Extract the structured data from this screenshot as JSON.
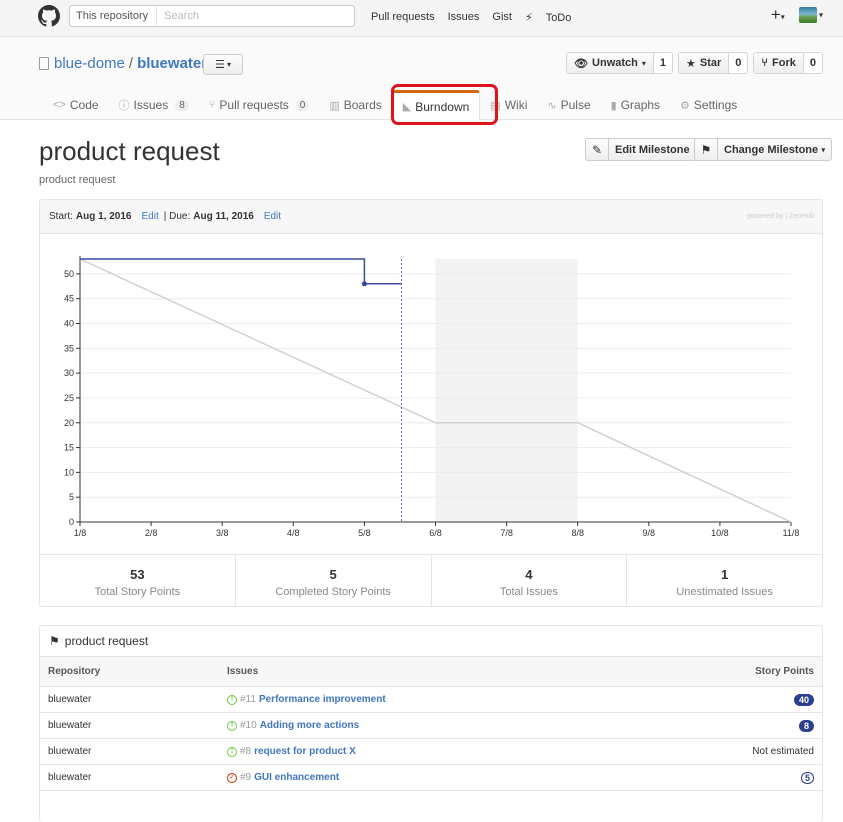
{
  "header": {
    "search_scope": "This repository",
    "search_placeholder": "Search",
    "nav": [
      "Pull requests",
      "Issues",
      "Gist",
      "ToDo"
    ]
  },
  "repo": {
    "owner": "blue-dome",
    "name": "bluewater",
    "watch_label": "Unwatch",
    "watch_count": "1",
    "star_label": "Star",
    "star_count": "0",
    "fork_label": "Fork",
    "fork_count": "0"
  },
  "tabs": [
    {
      "label": "Code",
      "icon": "code-icon"
    },
    {
      "label": "Issues",
      "icon": "issue-icon",
      "badge": "8"
    },
    {
      "label": "Pull requests",
      "icon": "pull-request-icon",
      "badge": "0"
    },
    {
      "label": "Boards",
      "icon": "boards-icon"
    },
    {
      "label": "Burndown",
      "icon": "burndown-icon",
      "active": true
    },
    {
      "label": "Wiki",
      "icon": "wiki-icon"
    },
    {
      "label": "Pulse",
      "icon": "pulse-icon"
    },
    {
      "label": "Graphs",
      "icon": "graphs-icon"
    },
    {
      "label": "Settings",
      "icon": "gear-icon"
    }
  ],
  "milestone": {
    "title": "product request",
    "subtitle": "product request",
    "edit_label": "Edit Milestone",
    "change_label": "Change Milestone"
  },
  "burndown": {
    "start_label": "Start:",
    "start_date": "Aug 1, 2016",
    "edit1": "Edit",
    "due_label": "| Due:",
    "due_date": "Aug 11, 2016",
    "edit2": "Edit",
    "powered": "powered by | ZenHub"
  },
  "chart_data": {
    "type": "line",
    "x_ticks": [
      "1/8",
      "2/8",
      "3/8",
      "4/8",
      "5/8",
      "6/8",
      "7/8",
      "8/8",
      "9/8",
      "10/8",
      "11/8"
    ],
    "y_ticks": [
      0,
      5,
      10,
      15,
      20,
      25,
      30,
      35,
      40,
      45,
      50
    ],
    "ylim": [
      0,
      53
    ],
    "series": [
      {
        "values": [
          [
            0,
            53
          ],
          [
            5,
            20
          ],
          [
            7,
            20
          ],
          [
            10,
            0
          ]
        ],
        "color": "#d0d0d0"
      },
      {
        "values": [
          [
            0,
            53
          ],
          [
            4,
            53
          ],
          [
            4,
            48
          ],
          [
            4.52,
            48
          ]
        ],
        "color": "#3a4ba0"
      }
    ],
    "today_x": 4.52,
    "weekend_range": [
      5,
      7
    ],
    "grid": true
  },
  "stats": [
    {
      "value": "53",
      "label": "Total Story Points"
    },
    {
      "value": "5",
      "label": "Completed Story Points"
    },
    {
      "value": "4",
      "label": "Total Issues"
    },
    {
      "value": "1",
      "label": "Unestimated Issues"
    }
  ],
  "issues": {
    "heading": "product request",
    "columns": [
      "Repository",
      "Issues",
      "Story Points"
    ],
    "rows": [
      {
        "repo": "bluewater",
        "num": "#11",
        "title": "Performance improvement",
        "points": "40",
        "state": "open"
      },
      {
        "repo": "bluewater",
        "num": "#10",
        "title": "Adding more actions",
        "points": "8",
        "state": "open"
      },
      {
        "repo": "bluewater",
        "num": "#8",
        "title": "request for product X",
        "points": "Not estimated",
        "state": "open"
      },
      {
        "repo": "bluewater",
        "num": "#9",
        "title": "GUI enhancement",
        "points": "5",
        "state": "closed"
      }
    ]
  }
}
